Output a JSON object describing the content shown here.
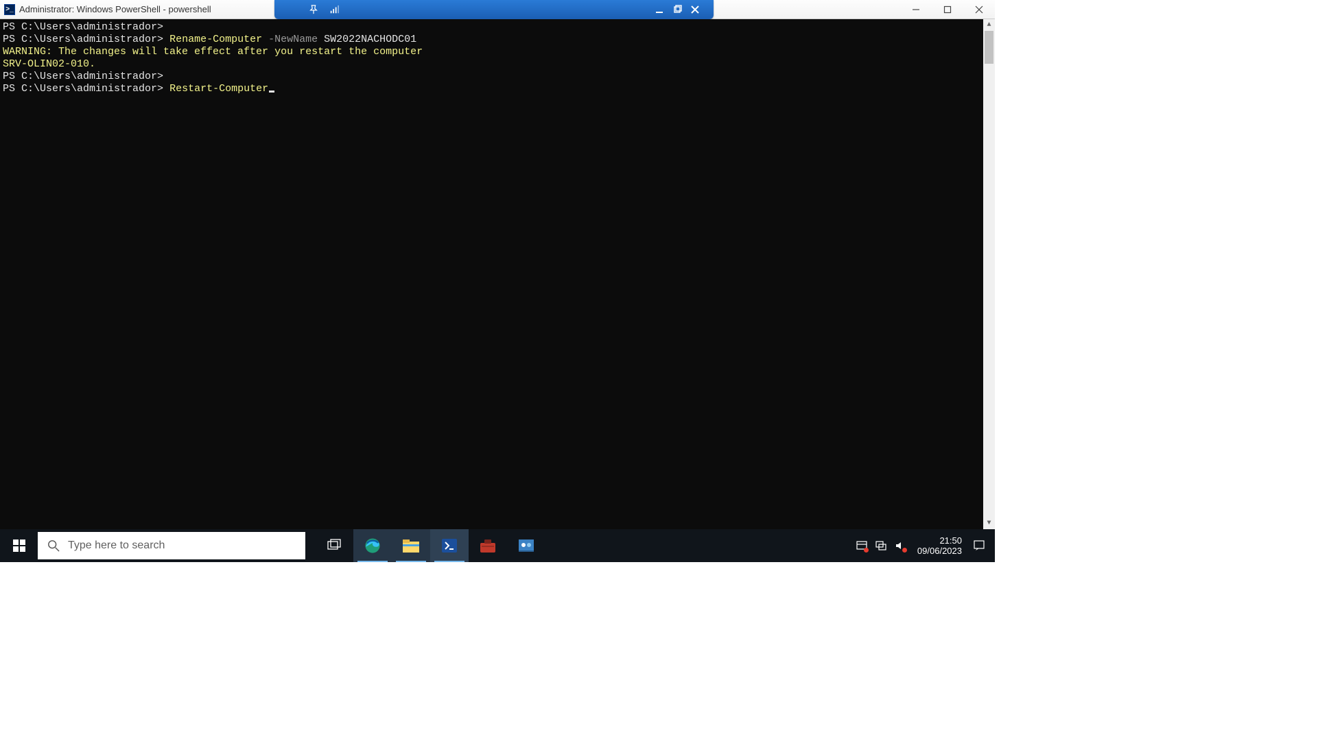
{
  "window": {
    "title": "Administrator: Windows PowerShell - powershell"
  },
  "vm_toolbar": {
    "pin_icon": "pin",
    "signal_icon": "signal",
    "minimize_icon": "minimize",
    "restore_icon": "restore",
    "close_icon": "close"
  },
  "terminal": {
    "lines": [
      {
        "prompt": "PS C:\\Users\\administrador>",
        "cmd": "",
        "param": "",
        "arg": ""
      },
      {
        "prompt": "PS C:\\Users\\administrador>",
        "cmd": "Rename-Computer",
        "param": "-NewName",
        "arg": "SW2022NACHODC01"
      }
    ],
    "warning_l1": "WARNING: The changes will take effect after you restart the computer",
    "warning_l2": "SRV-OLIN02-010.",
    "lines2": [
      {
        "prompt": "PS C:\\Users\\administrador>",
        "cmd": "",
        "param": "",
        "arg": ""
      },
      {
        "prompt": "PS C:\\Users\\administrador>",
        "cmd": "Restart-Computer",
        "param": "",
        "arg": ""
      }
    ]
  },
  "taskbar": {
    "search_placeholder": "Type here to search",
    "clock_time": "21:50",
    "clock_date": "09/06/2023",
    "items": {
      "start": "start",
      "taskview": "task-view",
      "edge": "edge",
      "explorer": "file-explorer",
      "powershell": "powershell",
      "toolbox": "toolbox",
      "control": "control-panel"
    }
  }
}
